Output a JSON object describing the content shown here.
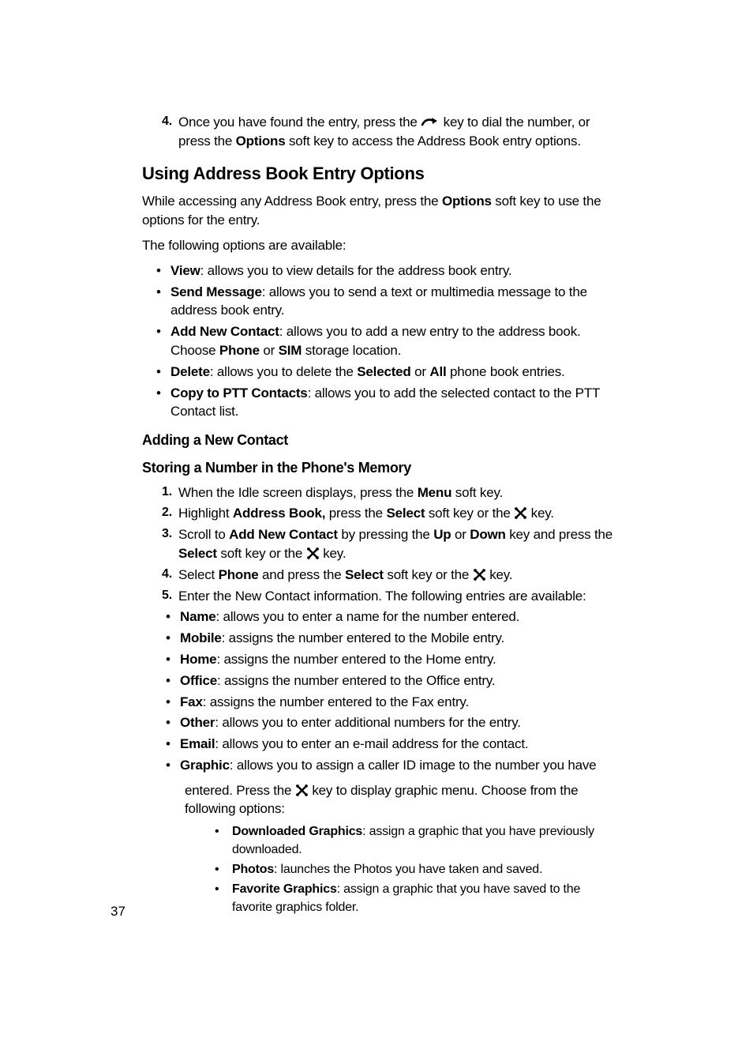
{
  "page_number": "37",
  "step4_top": {
    "num": "4.",
    "pre": "Once you have found the entry, press the ",
    "post": " key to dial the number, or press the ",
    "b1": "Options",
    "tail": " soft key to access the Address Book entry options."
  },
  "h1": "Using Address Book Entry Options",
  "intro1_pre": "While accessing any Address Book entry, press the ",
  "intro1_b": "Options",
  "intro1_post": " soft key to use the options for the entry.",
  "intro2": "The following options are available:",
  "options": {
    "view": {
      "label": "View",
      "text": ": allows you to view details for the address book entry."
    },
    "send": {
      "label": "Send Message",
      "text": ": allows you to send a text or multimedia message to the address book entry."
    },
    "add": {
      "label": "Add New Contact",
      "text1": ": allows you to add a new entry to the address book. Choose ",
      "b1": "Phone",
      "mid": " or ",
      "b2": "SIM",
      "text2": " storage location."
    },
    "delete": {
      "label": "Delete",
      "text1": ": allows you to delete the ",
      "b1": "Selected",
      "mid": " or ",
      "b2": "All",
      "text2": " phone book entries."
    },
    "copy": {
      "label": "Copy to PTT Contacts",
      "text": ": allows you to add the selected contact to the PTT Contact list."
    }
  },
  "h2a": "Adding a New Contact",
  "h2b": "Storing a Number in the Phone's Memory",
  "steps": {
    "s1": {
      "num": "1.",
      "pre": "When the Idle screen displays, press the ",
      "b1": "Menu",
      "post": " soft key."
    },
    "s2": {
      "num": "2.",
      "pre": "Highlight ",
      "b1": "Address Book,",
      "mid": " press the ",
      "b2": "Select",
      "post": " soft key or the ",
      "tail": " key."
    },
    "s3": {
      "num": "3.",
      "pre": "Scroll to ",
      "b1": "Add New Contact",
      "mid": " by pressing the ",
      "b2": "Up",
      "or": " or ",
      "b3": "Down",
      "post": " key and press the ",
      "b4": "Select",
      "mid2": " soft key or the ",
      "tail": " key."
    },
    "s4": {
      "num": "4.",
      "pre": "Select ",
      "b1": "Phone",
      "mid": " and press the ",
      "b2": "Select",
      "post": " soft key or the ",
      "tail": " key."
    },
    "s5": {
      "num": "5.",
      "text": "Enter the New Contact information. The following entries are available:"
    }
  },
  "fields": {
    "name": {
      "label": "Name",
      "text": ": allows you to enter a name for the number entered."
    },
    "mobile": {
      "label": "Mobile",
      "text": ": assigns the number entered to the Mobile entry."
    },
    "home": {
      "label": "Home",
      "text": ": assigns the number entered to the Home entry."
    },
    "office": {
      "label": "Office",
      "text": ": assigns the number entered to the Office entry."
    },
    "fax": {
      "label": "Fax",
      "text": ": assigns the number entered to the Fax entry."
    },
    "other": {
      "label": "Other",
      "text": ": allows you to enter additional numbers for the entry."
    },
    "email": {
      "label": "Email",
      "text": ": allows you to enter an e-mail address for the contact."
    },
    "graphic": {
      "label": "Graphic",
      "text": ": allows you to assign a caller ID image to the number you have"
    }
  },
  "graphic_cont": {
    "pre": "entered. Press the ",
    "post": " key to display graphic menu. Choose from the following options:"
  },
  "graphic_opts": {
    "downloaded": {
      "label": "Downloaded Graphics",
      "text": ": assign a graphic that you have previously downloaded."
    },
    "photos": {
      "label": "Photos",
      "text": ": launches the Photos you have taken and saved."
    },
    "favorite": {
      "label": "Favorite Graphics",
      "text": ": assign a graphic that you have saved to the favorite graphics folder."
    }
  }
}
